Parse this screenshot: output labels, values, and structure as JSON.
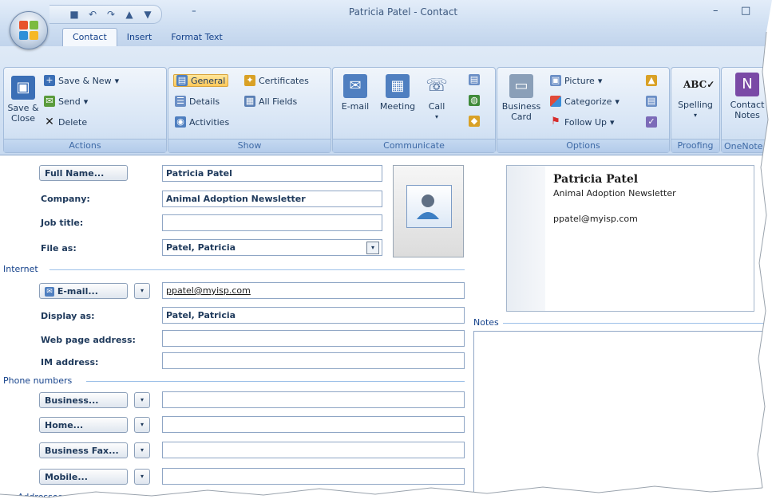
{
  "window": {
    "title": "Patricia Patel - Contact",
    "minimize": "–",
    "maximize": "□"
  },
  "qat": {
    "more": "⁼"
  },
  "tabs": [
    "Contact",
    "Insert",
    "Format Text"
  ],
  "ribbon": {
    "actions": {
      "label": "Actions",
      "save_close": "Save & Close",
      "save_new": "Save & New",
      "send": "Send",
      "delete": "Delete"
    },
    "show": {
      "label": "Show",
      "general": "General",
      "certificates": "Certificates",
      "details": "Details",
      "all_fields": "All Fields",
      "activities": "Activities"
    },
    "communicate": {
      "label": "Communicate",
      "email": "E-mail",
      "meeting": "Meeting",
      "call": "Call"
    },
    "options": {
      "label": "Options",
      "business_card": "Business Card",
      "picture": "Picture",
      "categorize": "Categorize",
      "follow_up": "Follow Up"
    },
    "proofing": {
      "label": "Proofing",
      "spelling": "Spelling"
    },
    "onenote": {
      "label": "OneNote",
      "contact_notes": "Contact Notes"
    }
  },
  "form": {
    "full_name_btn": "Full Name...",
    "full_name": "Patricia Patel",
    "company_label": "Company:",
    "company": "Animal Adoption Newsletter",
    "job_title_label": "Job title:",
    "job_title": "",
    "file_as_label": "File as:",
    "file_as": "Patel, Patricia",
    "internet_section": "Internet",
    "email_btn": "E-mail...",
    "email": "ppatel@myisp.com",
    "display_as_label": "Display as:",
    "display_as": "Patel, Patricia",
    "web_label": "Web page address:",
    "web": "",
    "im_label": "IM address:",
    "im": "",
    "phone_section": "Phone numbers",
    "business_btn": "Business...",
    "business": "",
    "home_btn": "Home...",
    "home": "",
    "business_fax_btn": "Business Fax...",
    "business_fax": "",
    "mobile_btn": "Mobile...",
    "mobile": "",
    "addresses_section": "Addresses",
    "notes_section": "Notes",
    "notes": ""
  },
  "card": {
    "name": "Patricia Patel",
    "company": "Animal Adoption Newsletter",
    "email": "ppatel@myisp.com"
  }
}
